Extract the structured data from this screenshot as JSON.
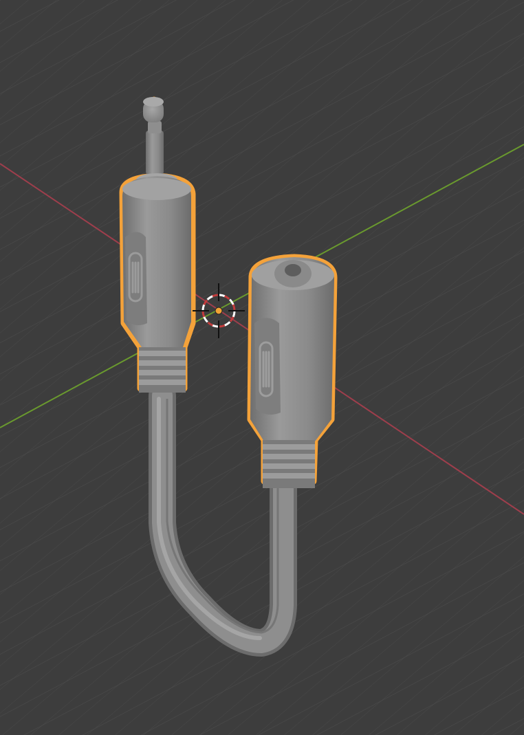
{
  "viewport": {
    "background": "#3d3d3d",
    "grid_color": "#4b4b4b",
    "x_axis_color": "#9e3e4c",
    "y_axis_color": "#6a9a2e",
    "selection_outline_color": "#f4a23a",
    "object_base_color": "#8c8c8c",
    "origin_dot_color": "#f2a335",
    "cursor_ring_colors": [
      "#c23b3b",
      "#ffffff"
    ]
  },
  "scene": {
    "object": "audio-extension-cable",
    "male_plug": {
      "emboss_icon": "grip-icon"
    },
    "female_socket": {
      "emboss_icon": "grip-icon"
    },
    "gizmo": "3d-cursor-icon"
  }
}
